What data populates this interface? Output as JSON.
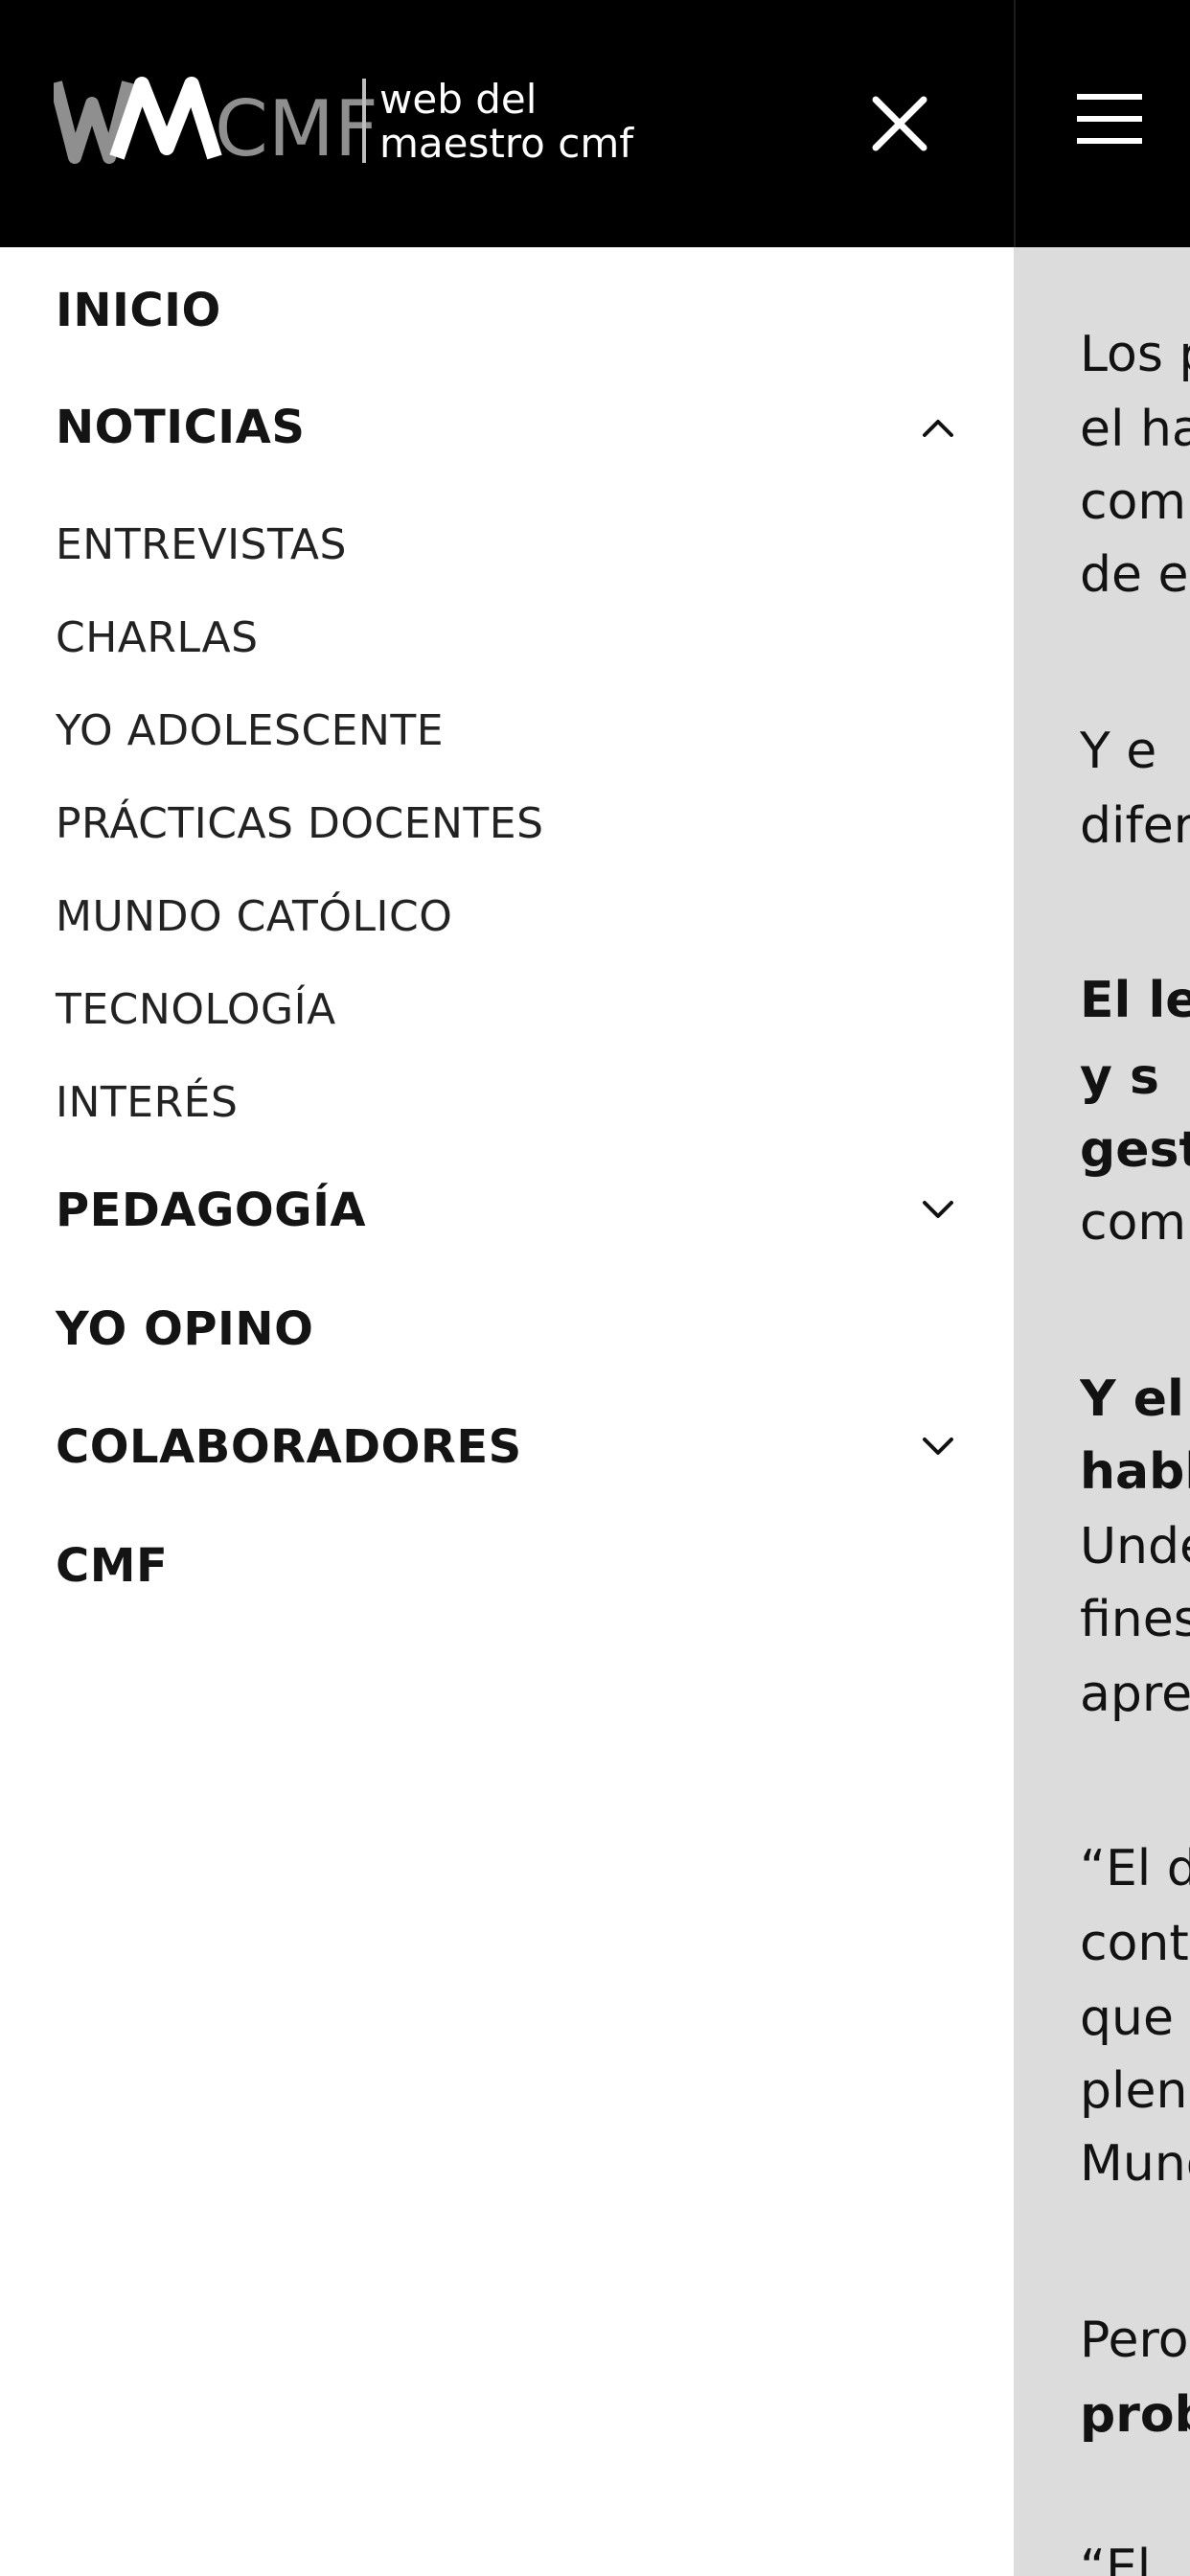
{
  "header": {
    "logo": {
      "mark": "WMCMF",
      "line1": "web del",
      "line2": "maestro cmf",
      "icon": "site-logo"
    },
    "close_icon": "close-icon",
    "menu_icon": "hamburger-menu-icon"
  },
  "menu": {
    "items": [
      {
        "label": "INICIO",
        "type": "main"
      },
      {
        "label": "NOTICIAS",
        "type": "main",
        "chevron": "up"
      },
      {
        "label": "ENTREVISTAS",
        "type": "sub"
      },
      {
        "label": "CHARLAS",
        "type": "sub"
      },
      {
        "label": "YO ADOLESCENTE",
        "type": "sub"
      },
      {
        "label": "PRÁCTICAS DOCENTES",
        "type": "sub"
      },
      {
        "label": "MUNDO CATÓLICO",
        "type": "sub"
      },
      {
        "label": "TECNOLOGÍA",
        "type": "sub"
      },
      {
        "label": "INTERÉS",
        "type": "sub"
      },
      {
        "label": "PEDAGOGÍA",
        "type": "main",
        "chevron": "down"
      },
      {
        "label": "YO OPINO",
        "type": "main"
      },
      {
        "label": "COLABORADORES",
        "type": "main",
        "chevron": "down"
      },
      {
        "label": "CMF",
        "type": "main"
      }
    ]
  },
  "article_fragments": [
    {
      "text": "Los p",
      "bold": false
    },
    {
      "text": "el ha",
      "bold": false
    },
    {
      "text": "comp",
      "bold": false
    },
    {
      "text": "de e",
      "bold": false
    },
    {
      "text": "Y   e",
      "bold": false
    },
    {
      "text": "difer",
      "bold": false
    },
    {
      "text": "El le",
      "bold": true
    },
    {
      "text": "y   s",
      "bold": true
    },
    {
      "text": "gest",
      "bold": true
    },
    {
      "text": "comu",
      "bold": false
    },
    {
      "text": "Y   el",
      "bold": true
    },
    {
      "text": "habl",
      "bold": true
    },
    {
      "text": "Unde",
      "bold": false
    },
    {
      "text": "fines",
      "bold": false
    },
    {
      "text": "apre",
      "bold": false
    },
    {
      "text": "“El d",
      "bold": false
    },
    {
      "text": "cont",
      "bold": false
    },
    {
      "text": "que",
      "bold": false
    },
    {
      "text": "plena",
      "bold": false
    },
    {
      "text": "Mund",
      "bold": false
    },
    {
      "text": "Pero",
      "bold": false
    },
    {
      "text": "prob",
      "bold": true
    },
    {
      "text": "“El",
      "bold": false
    }
  ],
  "colors": {
    "header_bg": "#000000",
    "drawer_bg": "#ffffff",
    "page_bg": "#dcdcdc",
    "text": "#141414",
    "logo_gray": "#9a9a9a",
    "logo_white": "#ffffff"
  }
}
